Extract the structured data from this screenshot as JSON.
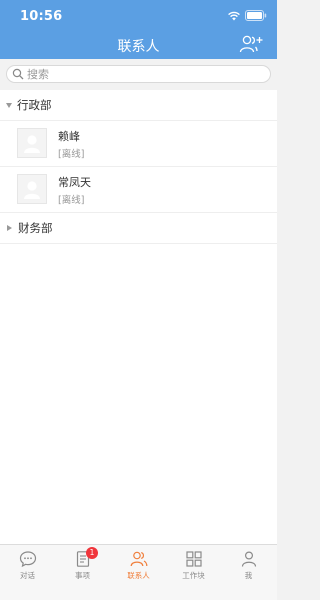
{
  "status_bar": {
    "time": "10:56"
  },
  "header": {
    "title": "联系人"
  },
  "search": {
    "placeholder": "搜索"
  },
  "groups": [
    {
      "name": "行政部",
      "expanded": true,
      "contacts": [
        {
          "name": "赖峰",
          "status": "[离线]"
        },
        {
          "name": "常凤天",
          "status": "[离线]"
        }
      ]
    },
    {
      "name": "财务部",
      "expanded": false,
      "contacts": []
    }
  ],
  "tabbar": {
    "active": "联系人",
    "active_color": "#f07f3c",
    "tabs": [
      {
        "label": "对话",
        "icon": "chat-icon"
      },
      {
        "label": "事项",
        "icon": "document-icon",
        "badge": "1"
      },
      {
        "label": "联系人",
        "icon": "contacts-icon"
      },
      {
        "label": "工作块",
        "icon": "grid-icon"
      },
      {
        "label": "我",
        "icon": "person-icon"
      }
    ]
  },
  "colors": {
    "header_bg": "#5b9fe3",
    "badge": "#f0353b"
  }
}
